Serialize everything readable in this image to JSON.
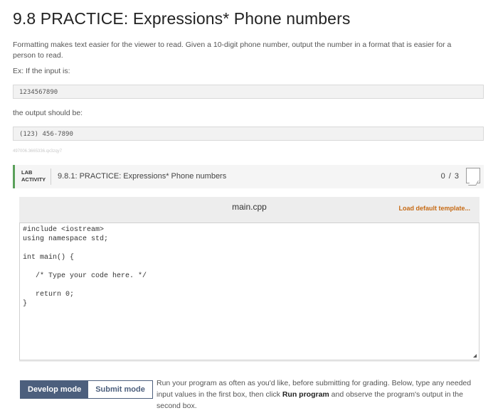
{
  "page": {
    "title": "9.8 PRACTICE: Expressions* Phone numbers",
    "intro": "Formatting makes text easier for the viewer to read. Given a 10-digit phone number, output the number in a format that is easier for a person to read.",
    "example_label": "Ex: If the input is:",
    "example_input": "1234567890",
    "output_label": "the output should be:",
    "example_output": "(123) 456-7890",
    "tiny_id": "497006.3665336.qx3zqy7"
  },
  "lab": {
    "tag_line1": "LAB",
    "tag_line2": "ACTIVITY",
    "title": "9.8.1: PRACTICE: Expressions* Phone numbers",
    "score": "0 / 3"
  },
  "editor": {
    "file_name": "main.cpp",
    "load_template_label": "Load default template...",
    "code": "#include <iostream>\nusing namespace std;\n\nint main() {\n\n   /* Type your code here. */\n\n   return 0;\n}"
  },
  "modes": {
    "develop_label": "Develop mode",
    "submit_label": "Submit mode",
    "instructions_part1": "Run your program as often as you'd like, before submitting for grading. Below, type any needed input values in the first box, then click ",
    "instructions_bold": "Run program",
    "instructions_part2": " and observe the program's output in the second box."
  },
  "colors": {
    "accent_green": "#5aa05a",
    "mode_active_bg": "#4c5f7d",
    "link_orange": "#c66a14"
  }
}
